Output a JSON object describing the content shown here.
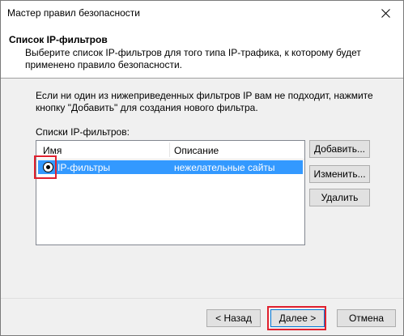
{
  "window": {
    "title": "Мастер правил безопасности",
    "close_symbol": "✕"
  },
  "header": {
    "title": "Список IP-фильтров",
    "description": "Выберите список IP-фильтров для того типа IP-трафика, к которому будет применено правило безопасности."
  },
  "main": {
    "intro": "Если ни один из нижеприведенных фильтров IP вам не подходит, нажмите кнопку \"Добавить\" для создания нового фильтра.",
    "list_label": "Списки IP-фильтров:",
    "columns": [
      "Имя",
      "Описание"
    ],
    "rows": [
      {
        "name": "IP-фильтры",
        "description": "нежелательные сайты",
        "selected": true,
        "icon": "radio-selected-icon"
      }
    ],
    "buttons": {
      "add": "Добавить...",
      "edit": "Изменить...",
      "delete": "Удалить"
    }
  },
  "footer": {
    "back": "< Назад",
    "next": "Далее >",
    "cancel": "Отмена"
  },
  "colors": {
    "selection": "#3399ff",
    "highlight_border": "#e0202e",
    "default_button_border": "#0078d7"
  }
}
